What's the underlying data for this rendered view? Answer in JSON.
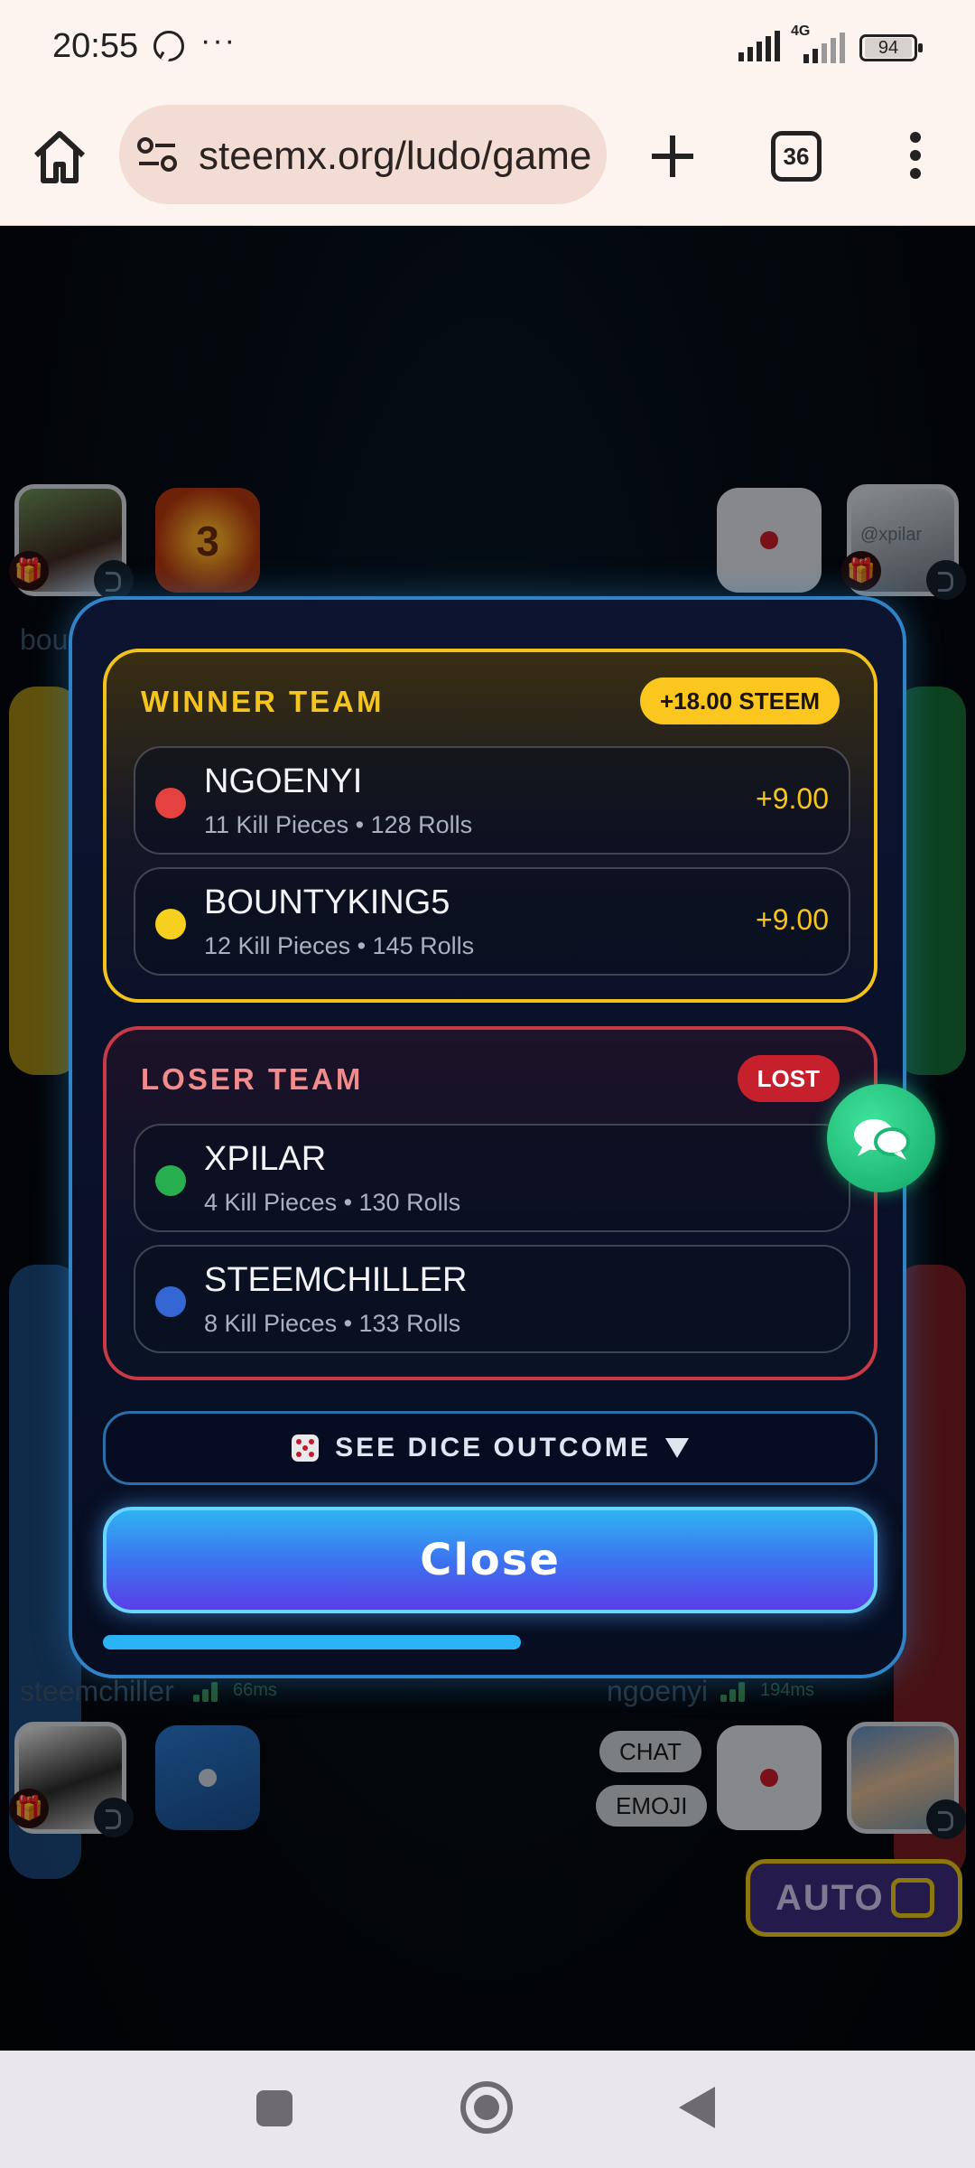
{
  "status_bar": {
    "time": "20:55",
    "more": "···",
    "network": "4G",
    "battery": "94"
  },
  "browser": {
    "url": "steemx.org/ludo/game",
    "tab_count": "36"
  },
  "players": {
    "top_left_name": "bou",
    "avatar_top_right": "@xpilar",
    "pumpkin_number": "3",
    "bottom_left": {
      "name": "steemchiller",
      "ping": "66ms"
    },
    "bottom_right": {
      "name": "ngoenyi",
      "ping": "194ms"
    }
  },
  "game_controls": {
    "chat": "CHAT",
    "emoji": "EMOJI",
    "auto": "AUTO"
  },
  "modal": {
    "winner": {
      "title": "WINNER TEAM",
      "badge": "+18.00 STEEM",
      "players": [
        {
          "name": "NGOENYI",
          "stats": "11 Kill Pieces • 128 Rolls",
          "score": "+9.00",
          "color": "#e5413f"
        },
        {
          "name": "BOUNTYKING5",
          "stats": "12 Kill Pieces • 145 Rolls",
          "score": "+9.00",
          "color": "#f7cf1e"
        }
      ]
    },
    "loser": {
      "title": "LOSER TEAM",
      "badge": "LOST",
      "players": [
        {
          "name": "XPILAR",
          "stats": "4 Kill Pieces • 130 Rolls",
          "color": "#27ae4f"
        },
        {
          "name": "STEEMCHILLER",
          "stats": "8 Kill Pieces • 133 Rolls",
          "color": "#3567d4"
        }
      ]
    },
    "dice_outcome_label": "SEE DICE OUTCOME",
    "close_label": "Close",
    "progress_fraction": 0.54
  }
}
